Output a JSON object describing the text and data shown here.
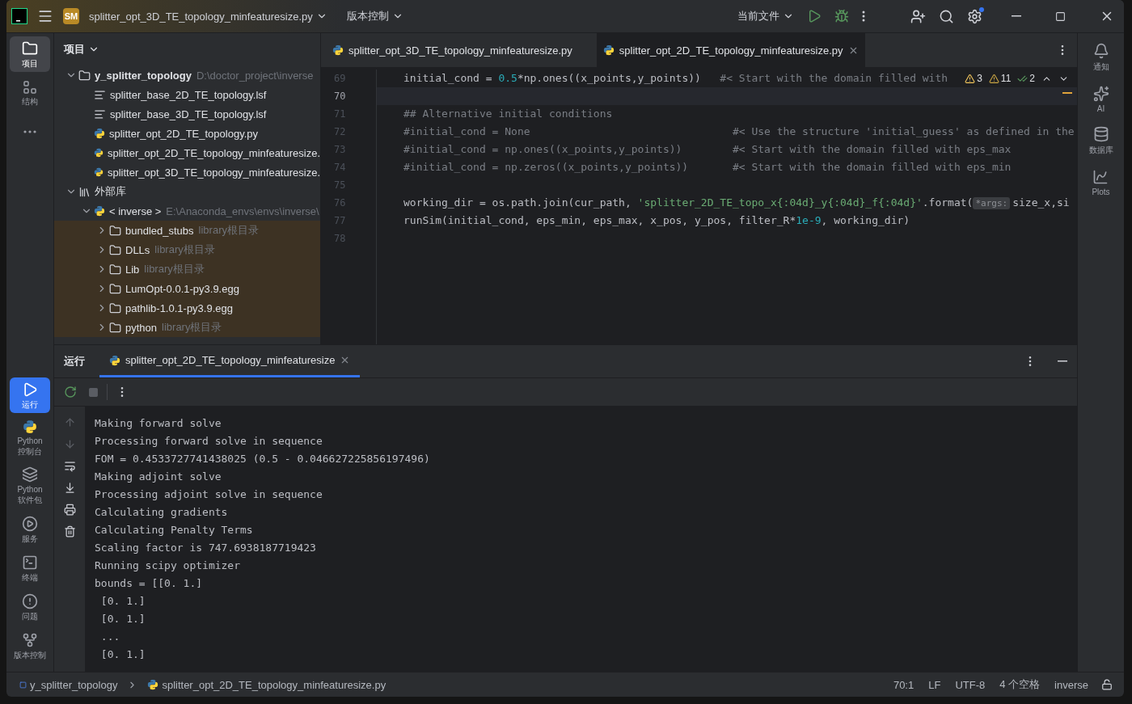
{
  "title_bar": {
    "project_badge": "SM",
    "project_name": "splitter_opt_3D_TE_topology_minfeaturesize.py",
    "vcs": "版本控制",
    "run_config": "当前文件",
    "settings_notification": true
  },
  "left_toolbar": {
    "top": [
      {
        "label": "项目",
        "selected": true
      },
      {
        "label": "结构",
        "selected": false
      },
      {
        "selected": false
      }
    ],
    "bottom": [
      {
        "label": "运行",
        "selected": true
      },
      {
        "label": "Python\n控制台",
        "selected": false
      },
      {
        "label": "Python\n软件包",
        "selected": false
      },
      {
        "label": "服务",
        "selected": false
      },
      {
        "label": "终端",
        "selected": false
      },
      {
        "label": "问题",
        "selected": false
      },
      {
        "label": "版本控制",
        "selected": false
      }
    ]
  },
  "project_panel": {
    "title": "项目",
    "tree": [
      {
        "label": "y_splitter_topology",
        "path": "D:\\doctor_project\\inverse",
        "kind": "folder",
        "expanded": true,
        "children": [
          {
            "label": "splitter_base_2D_TE_topology.lsf",
            "kind": "text"
          },
          {
            "label": "splitter_base_3D_TE_topology.lsf",
            "kind": "text"
          },
          {
            "label": "splitter_opt_2D_TE_topology.py",
            "kind": "python"
          },
          {
            "label": "splitter_opt_2D_TE_topology_minfeaturesize.",
            "kind": "python"
          },
          {
            "label": "splitter_opt_3D_TE_topology_minfeaturesize.",
            "kind": "python"
          }
        ]
      },
      {
        "label": "外部库",
        "kind": "library",
        "expanded": true,
        "children": [
          {
            "label": "< inverse >",
            "path": "E:\\Anaconda_envs\\envs\\inverse\\",
            "kind": "python",
            "expanded": true,
            "children": [
              {
                "label": "bundled_stubs",
                "hint": "library根目录",
                "kind": "folder",
                "expanded": false,
                "highlighted": true
              },
              {
                "label": "DLLs",
                "hint": "library根目录",
                "kind": "folder",
                "expanded": false,
                "highlighted": true
              },
              {
                "label": "Lib",
                "hint": "library根目录",
                "kind": "folder",
                "expanded": false,
                "highlighted": true
              },
              {
                "label": "LumOpt-0.0.1-py3.9.egg",
                "kind": "folder",
                "expanded": false,
                "highlighted": true
              },
              {
                "label": "pathlib-1.0.1-py3.9.egg",
                "kind": "folder",
                "expanded": false,
                "highlighted": true
              },
              {
                "label": "python",
                "hint": "library根目录",
                "kind": "folder",
                "expanded": false,
                "highlighted": true
              }
            ]
          }
        ]
      }
    ]
  },
  "editor": {
    "tabs": [
      {
        "label": "splitter_opt_3D_TE_topology_minfeaturesize.py",
        "selected": false
      },
      {
        "label": "splitter_opt_2D_TE_topology_minfeaturesize.py",
        "selected": true
      }
    ],
    "inspections": {
      "errors": "3",
      "warnings": "11",
      "ok": "2"
    },
    "lines": [
      {
        "number": "69",
        "current": false,
        "segments": [
          {
            "kind": "plain",
            "text": "initial_cond = "
          },
          {
            "kind": "number",
            "text": "0.5"
          },
          {
            "kind": "plain",
            "text": "*np.ones((x_points,y_points))   "
          },
          {
            "kind": "comment",
            "text": "#< Start with the domain filled with"
          }
        ]
      },
      {
        "number": "70",
        "current": true
      },
      {
        "number": "71",
        "current": false,
        "segments": [
          {
            "kind": "comment",
            "text": "## Alternative initial conditions"
          }
        ]
      },
      {
        "number": "72",
        "current": false,
        "segments": [
          {
            "kind": "comment",
            "text": "#initial_cond = None                                #< Use the structure 'initial_guess' as defined in the"
          }
        ]
      },
      {
        "number": "73",
        "current": false,
        "segments": [
          {
            "kind": "comment",
            "text": "#initial_cond = np.ones((x_points,y_points))        #< Start with the domain filled with eps_max"
          }
        ]
      },
      {
        "number": "74",
        "current": false,
        "segments": [
          {
            "kind": "comment",
            "text": "#initial_cond = np.zeros((x_points,y_points))       #< Start with the domain filled with eps_min"
          }
        ]
      },
      {
        "number": "75",
        "current": false
      },
      {
        "number": "76",
        "current": false,
        "segments": [
          {
            "kind": "plain",
            "text": "working_dir = os.path.join(cur_path, "
          },
          {
            "kind": "string",
            "text": "'splitter_2D_TE_topo_x{:04d}_y{:04d}_f{:04d}'"
          },
          {
            "kind": "plain",
            "text": ".format("
          },
          {
            "kind": "hint",
            "text": "*args:"
          },
          {
            "kind": "plain",
            "text": "size_x,si"
          }
        ]
      },
      {
        "number": "77",
        "current": false,
        "segments": [
          {
            "kind": "plain",
            "text": "runSim(initial_cond, eps_min, eps_max, x_pos, y_pos, filter_R*"
          },
          {
            "kind": "number",
            "text": "1e-9"
          },
          {
            "kind": "plain",
            "text": ", working_dir)"
          }
        ]
      },
      {
        "number": "78",
        "current": false
      }
    ]
  },
  "right_toolbar": [
    {
      "label": "通知"
    },
    {
      "label": "AI"
    },
    {
      "label": "数据库"
    },
    {
      "label": "Plots"
    }
  ],
  "run_panel": {
    "title": "运行",
    "tabs": [
      {
        "label": "splitter_opt_2D_TE_topology_minfeaturesize",
        "selected": true
      }
    ],
    "output": [
      "Making forward solve",
      "Processing forward solve in sequence",
      "FOM = 0.4533727741438025 (0.5 - 0.046627225856197496)",
      "Making adjoint solve",
      "Processing adjoint solve in sequence",
      "Calculating gradients",
      "Calculating Penalty Terms",
      "Scaling factor is 747.6938187719423",
      "Running scipy optimizer",
      "bounds = [[0. 1.]",
      " [0. 1.]",
      " [0. 1.]",
      " ...",
      " [0. 1.]"
    ]
  },
  "status_bar": {
    "breadcrumbs": [
      "y_splitter_topology",
      "splitter_opt_2D_TE_topology_minfeaturesize.py"
    ],
    "position": "70:1",
    "line_separator": "LF",
    "encoding": "UTF-8",
    "indent": "4 个空格",
    "interpreter": "inverse"
  }
}
